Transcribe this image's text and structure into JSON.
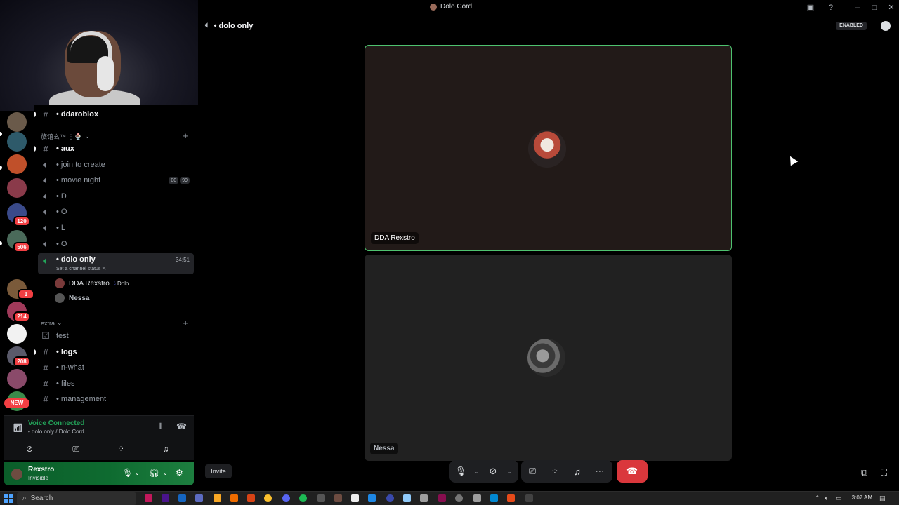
{
  "window": {
    "title": "Dolo Cord"
  },
  "channel_header": {
    "name": "• dolo only",
    "badge": "ENABLED"
  },
  "categories": [
    {
      "label": "旅馆ㄠ™ ⋮🍨"
    },
    {
      "label": "extra"
    }
  ],
  "channels": [
    {
      "name": "• ddaroblox",
      "type": "text",
      "unread": true
    },
    {
      "name": "• aux",
      "type": "text",
      "unread": true
    },
    {
      "name": "• join to create",
      "type": "voice"
    },
    {
      "name": "• movie night",
      "type": "voice",
      "pill1": "00",
      "pill2": "99"
    },
    {
      "name": "• D",
      "type": "voice"
    },
    {
      "name": "• O",
      "type": "voice"
    },
    {
      "name": "• L",
      "type": "voice"
    },
    {
      "name": "• O",
      "type": "voice"
    },
    {
      "name": "• dolo only",
      "type": "voice",
      "timer": "34:51",
      "status": "Set a channel status"
    },
    {
      "name": "test",
      "type": "rules"
    },
    {
      "name": "• logs",
      "type": "text",
      "unread": true
    },
    {
      "name": "• n-what",
      "type": "text"
    },
    {
      "name": "• files",
      "type": "text"
    },
    {
      "name": "• management",
      "type": "text"
    }
  ],
  "voice_members": [
    {
      "name": "DDA Rexstro",
      "tag": "Dolo"
    },
    {
      "name": "Nessa"
    }
  ],
  "server_badges": [
    "120",
    "506",
    "1",
    "214",
    "208"
  ],
  "new_badge": "NEW",
  "voice_panel": {
    "title": "Voice Connected",
    "subtitle": "• dolo only / Dolo Cord"
  },
  "user_panel": {
    "name": "Rexstro",
    "status": "Invisible"
  },
  "tiles": [
    {
      "name": "DDA Rexstro"
    },
    {
      "name": "Nessa"
    }
  ],
  "invite_label": "Invite",
  "taskbar": {
    "search_placeholder": "Search",
    "time": "3:07 AM"
  },
  "colors": {
    "accent_green": "#23a55a",
    "hangup_red": "#da373c",
    "speaking_border": "#4ec26f"
  }
}
